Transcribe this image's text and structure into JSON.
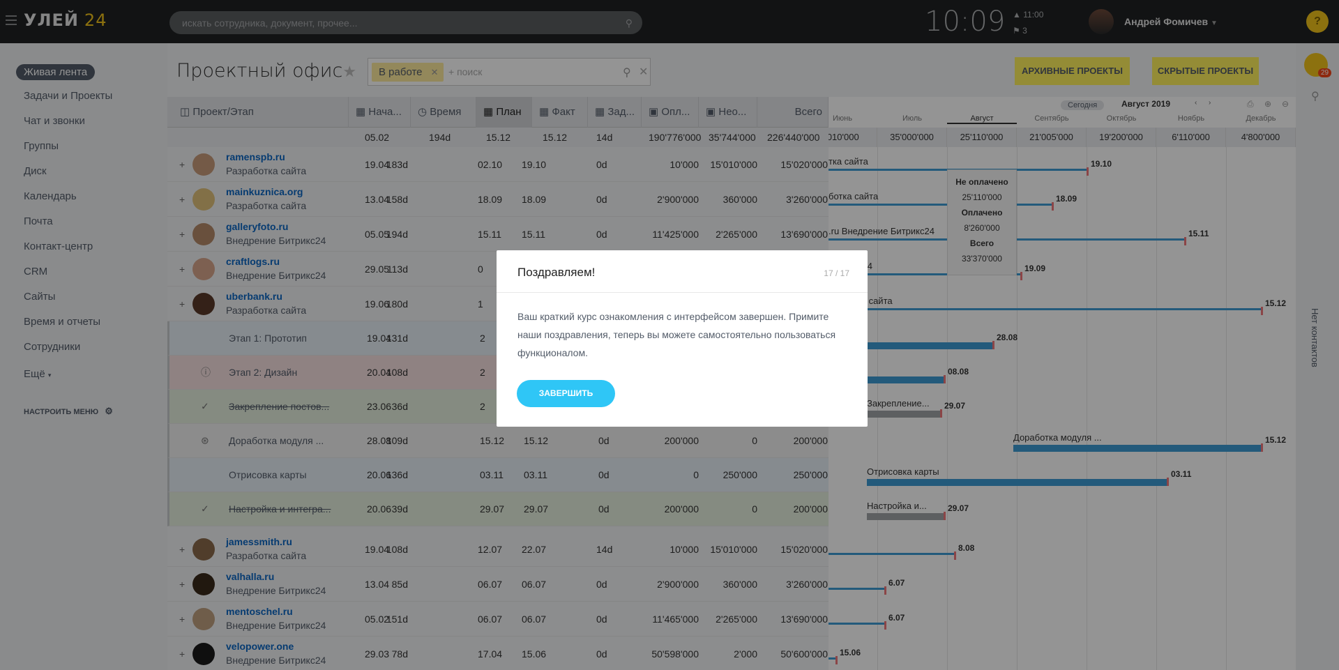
{
  "topbar": {
    "logo_text": "УЛЕЙ",
    "logo_num": "24",
    "search_placeholder": "искать сотрудника, документ, прочее...",
    "clock": "10:09",
    "alarm_time": "11:00",
    "flag_count": "3",
    "user_name": "Андрей Фомичев",
    "help": "?"
  },
  "sidebar": {
    "active": "Живая лента",
    "items": [
      "Задачи и Проекты",
      "Чат и звонки",
      "Группы",
      "Диск",
      "Календарь",
      "Почта",
      "Контакт-центр",
      "CRM",
      "Сайты",
      "Время и отчеты",
      "Сотрудники",
      "Ещё"
    ],
    "configure": "НАСТРОИТЬ МЕНЮ"
  },
  "page": {
    "title": "Проектный офис",
    "filter_chip": "В работе",
    "filter_add": "+ поиск",
    "archived_btn": "АРХИВНЫЕ ПРОЕКТЫ",
    "hidden_btn": "СКРЫТЫЕ ПРОЕКТЫ"
  },
  "table": {
    "headers": [
      "Проект/Этап",
      "Нача...",
      "Время",
      "План",
      "Факт",
      "Зад...",
      "Опл...",
      "Нео...",
      "Всего"
    ],
    "totals": [
      "05.02",
      "194d",
      "15.12",
      "15.12",
      "14d",
      "190'776'000",
      "35'744'000",
      "226'440'000"
    ],
    "rows": [
      {
        "name": "ramenspb.ru",
        "sub": "Разработка сайта",
        "vals": [
          "19.04",
          "183d",
          "02.10",
          "19.10",
          "0d",
          "10'000",
          "15'010'000",
          "15'020'000"
        ]
      },
      {
        "name": "mainkuznica.org",
        "sub": "Разработка сайта",
        "vals": [
          "13.04",
          "158d",
          "18.09",
          "18.09",
          "0d",
          "2'900'000",
          "360'000",
          "3'260'000"
        ]
      },
      {
        "name": "galleryfoto.ru",
        "sub": "Внедрение Битрикс24",
        "vals": [
          "05.05",
          "194d",
          "15.11",
          "15.11",
          "0d",
          "11'425'000",
          "2'265'000",
          "13'690'000"
        ]
      },
      {
        "name": "craftlogs.ru",
        "sub": "Внедрение Битрикс24",
        "vals": [
          "29.05",
          "113d",
          "0",
          "",
          "",
          "",
          "",
          ""
        ]
      },
      {
        "name": "uberbank.ru",
        "sub": "Разработка сайта",
        "vals": [
          "19.06",
          "180d",
          "1",
          "",
          "",
          "",
          "",
          ""
        ]
      }
    ],
    "stages": [
      {
        "name": "Этап 1: Прототип",
        "vals": [
          "19.04",
          "131d",
          "2"
        ]
      },
      {
        "name": "Этап 2: Дизайн",
        "vals": [
          "20.04",
          "108d",
          "2"
        ]
      },
      {
        "name": "Закрепление постов...",
        "vals": [
          "23.06",
          "36d",
          "2"
        ]
      },
      {
        "name": "Доработка модуля ...",
        "vals": [
          "28.08",
          "109d",
          "15.12",
          "15.12",
          "0d",
          "200'000",
          "0",
          "200'000"
        ]
      },
      {
        "name": "Отрисовка карты",
        "vals": [
          "20.06",
          "136d",
          "03.11",
          "03.11",
          "0d",
          "0",
          "250'000",
          "250'000"
        ]
      },
      {
        "name": "Настройка и интегра...",
        "vals": [
          "20.06",
          "39d",
          "29.07",
          "29.07",
          "0d",
          "200'000",
          "0",
          "200'000"
        ]
      }
    ],
    "rows2": [
      {
        "name": "jamessmith.ru",
        "sub": "Разработка сайта",
        "vals": [
          "19.04",
          "108d",
          "12.07",
          "22.07",
          "14d",
          "10'000",
          "15'010'000",
          "15'020'000"
        ]
      },
      {
        "name": "valhalla.ru",
        "sub": "Внедрение Битрикс24",
        "vals": [
          "13.04",
          "85d",
          "06.07",
          "06.07",
          "0d",
          "2'900'000",
          "360'000",
          "3'260'000"
        ]
      },
      {
        "name": "mentoschel.ru",
        "sub": "Внедрение Битрикс24",
        "vals": [
          "05.02",
          "151d",
          "06.07",
          "06.07",
          "0d",
          "11'465'000",
          "2'265'000",
          "13'690'000"
        ]
      },
      {
        "name": "velopower.one",
        "sub": "Внедрение Битрикс24",
        "vals": [
          "29.03",
          "78d",
          "17.04",
          "15.06",
          "0d",
          "50'598'000",
          "2'000",
          "50'600'000"
        ]
      }
    ]
  },
  "gantt": {
    "today_btn": "Сегодня",
    "period": "Август 2019",
    "months": [
      "Июнь",
      "Июль",
      "Август",
      "Сентябрь",
      "Октябрь",
      "Ноябрь",
      "Декабрь"
    ],
    "month_sums": [
      "'010'000",
      "35'000'000",
      "25'110'000",
      "21'005'000",
      "19'200'000",
      "6'110'000",
      "4'800'000"
    ],
    "tooltip": [
      "Не оплачено",
      "25'110'000",
      "Оплачено",
      "8'260'000",
      "Всего",
      "33'370'000"
    ],
    "bars": [
      {
        "label": "тка сайта",
        "end": "19.10"
      },
      {
        "label": "ботка сайта",
        "end": "18.09"
      },
      {
        "label": ".ru Внедрение Битрикс24",
        "end": "15.11"
      },
      {
        "label": "Битрикс24",
        "end": "19.09"
      },
      {
        "label": "зработка сайта",
        "end": "15.12"
      },
      {
        "label": "",
        "end": "28.08"
      },
      {
        "label": "",
        "end": "08.08"
      },
      {
        "label": "Закрепление...",
        "end": "29.07"
      },
      {
        "label": "Доработка модуля ...",
        "end": "15.12"
      },
      {
        "label": "Отрисовка карты",
        "end": "03.11"
      },
      {
        "label": "Настройка и...",
        "end": "29.07"
      },
      {
        "label": "",
        "end": "8.08"
      },
      {
        "label": "",
        "end": "6.07"
      },
      {
        "label": "",
        "end": "6.07"
      },
      {
        "label": "",
        "end": "15.06"
      }
    ],
    "right_rail": "Нет контактов",
    "bell_badge": "29"
  },
  "modal": {
    "title": "Поздравляем!",
    "counter": "17 / 17",
    "text": "Ваш краткий курс ознакомления с интерфейсом завершен. Примите наши поздравления, теперь вы можете самостоятельно пользоваться функционалом.",
    "button": "ЗАВЕРШИТЬ"
  },
  "colors": {
    "accent": "#2fc6f6",
    "bar_blue": "#3d9bd4",
    "bar_grey": "#a0a4a8",
    "bar_overdue": "#f19a9a",
    "yellow": "#fff15d"
  }
}
